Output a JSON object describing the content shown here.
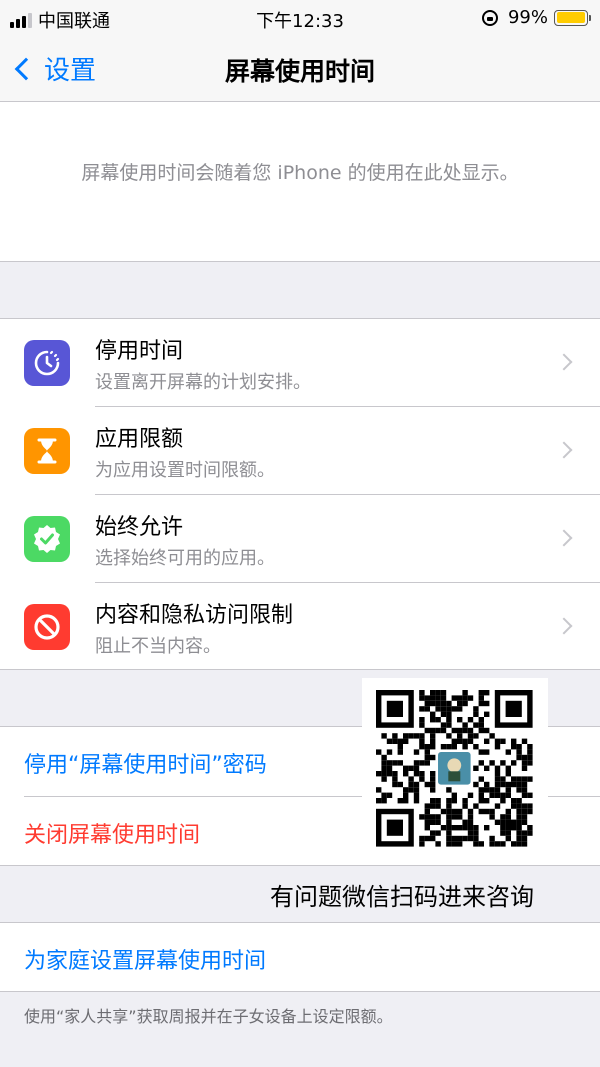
{
  "status_bar": {
    "carrier": "中国联通",
    "time": "下午12:33",
    "battery_percent": "99%",
    "battery_level": 0.99,
    "signal_bars_filled": 3,
    "signal_bars_total": 4
  },
  "nav": {
    "back_label": "设置",
    "title": "屏幕使用时间"
  },
  "intro": {
    "text": "屏幕使用时间会随着您 iPhone 的使用在此处显示。"
  },
  "features": [
    {
      "title": "停用时间",
      "subtitle": "设置离开屏幕的计划安排。",
      "icon": "downtime-icon",
      "color": "#5856d6"
    },
    {
      "title": "应用限额",
      "subtitle": "为应用设置时间限额。",
      "icon": "hourglass-icon",
      "color": "#ff9500"
    },
    {
      "title": "始终允许",
      "subtitle": "选择始终可用的应用。",
      "icon": "checkmark-badge-icon",
      "color": "#4cd964"
    },
    {
      "title": "内容和隐私访问限制",
      "subtitle": "阻止不当内容。",
      "icon": "no-entry-icon",
      "color": "#ff3b30"
    }
  ],
  "passcode": {
    "label": "停用“屏幕使用时间”密码",
    "color": "#007aff"
  },
  "turn_off": {
    "label": "关闭屏幕使用时间",
    "color": "#ff3b30"
  },
  "qr_overlay": {
    "caption": "有问题微信扫码进来咨询"
  },
  "family": {
    "label": "为家庭设置屏幕使用时间",
    "footer": "使用“家人共享”获取周报并在子女设备上设定限额。"
  }
}
